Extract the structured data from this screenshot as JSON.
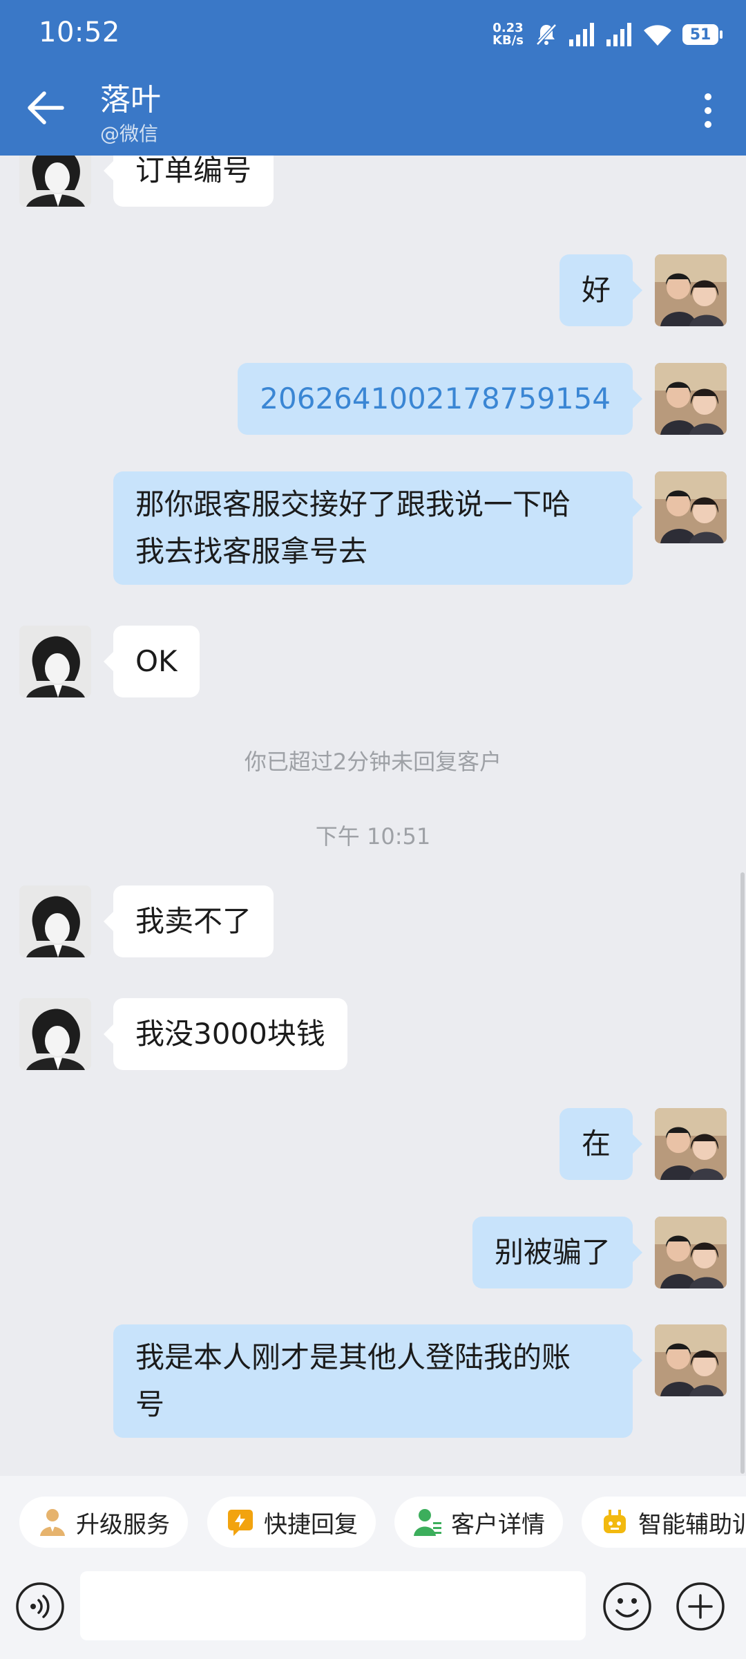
{
  "status_bar": {
    "time": "10:52",
    "net_speed_value": "0.23",
    "net_speed_unit": "KB/s",
    "battery": "51"
  },
  "header": {
    "title": "落叶",
    "subtitle": "@微信"
  },
  "messages": [
    {
      "side": "in",
      "text": "订单编号"
    },
    {
      "side": "out",
      "text": "好"
    },
    {
      "side": "out",
      "text": "2062641002178759154",
      "is_link": true
    },
    {
      "side": "out",
      "text": "那你跟客服交接好了跟我说一下哈\n我去找客服拿号去"
    },
    {
      "side": "in",
      "text": "OK"
    },
    {
      "side": "note",
      "text": "你已超过2分钟未回复客户"
    },
    {
      "side": "time",
      "text": "下午 10:51"
    },
    {
      "side": "in",
      "text": "我卖不了"
    },
    {
      "side": "in",
      "text": "我没3000块钱"
    },
    {
      "side": "out",
      "text": "在"
    },
    {
      "side": "out",
      "text": "别被骗了"
    },
    {
      "side": "out",
      "text": "我是本人刚才是其他人登陆我的账\n号"
    }
  ],
  "quick_actions": [
    {
      "label": "升级服务",
      "icon": "person-upgrade-icon"
    },
    {
      "label": "快捷回复",
      "icon": "quick-reply-icon"
    },
    {
      "label": "客户详情",
      "icon": "customer-detail-icon"
    },
    {
      "label": "智能辅助训",
      "icon": "robot-assist-icon"
    }
  ],
  "input": {
    "placeholder": ""
  },
  "colors": {
    "header_bg": "#3a78c7",
    "chat_bg": "#ebecf0",
    "outgoing_bubble": "#c8e3fb",
    "incoming_bubble": "#ffffff",
    "link_text": "#3a86d4"
  }
}
